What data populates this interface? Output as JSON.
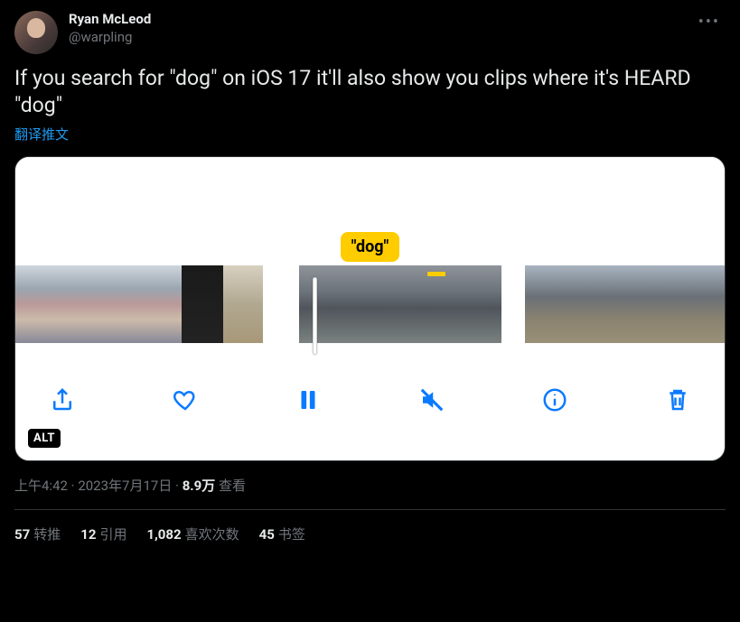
{
  "author": {
    "display_name": "Ryan McLeod",
    "handle": "@warpling"
  },
  "tweet_text": "If you search for \"dog\" on iOS 17 it'll also show you clips where it's HEARD \"dog\"",
  "translate_label": "翻译推文",
  "media": {
    "search_term": "\"dog\"",
    "alt_badge": "ALT",
    "toolbar_icons": [
      "share-icon",
      "heart-icon",
      "pause-icon",
      "mute-icon",
      "info-icon",
      "trash-icon"
    ]
  },
  "meta": {
    "time": "上午4:42",
    "date": "2023年7月17日",
    "views_count": "8.9万",
    "views_label": "查看",
    "sep": " · "
  },
  "stats": {
    "retweets_count": "57",
    "retweets_label": "转推",
    "quotes_count": "12",
    "quotes_label": "引用",
    "likes_count": "1,082",
    "likes_label": "喜欢次数",
    "bookmarks_count": "45",
    "bookmarks_label": "书签"
  }
}
